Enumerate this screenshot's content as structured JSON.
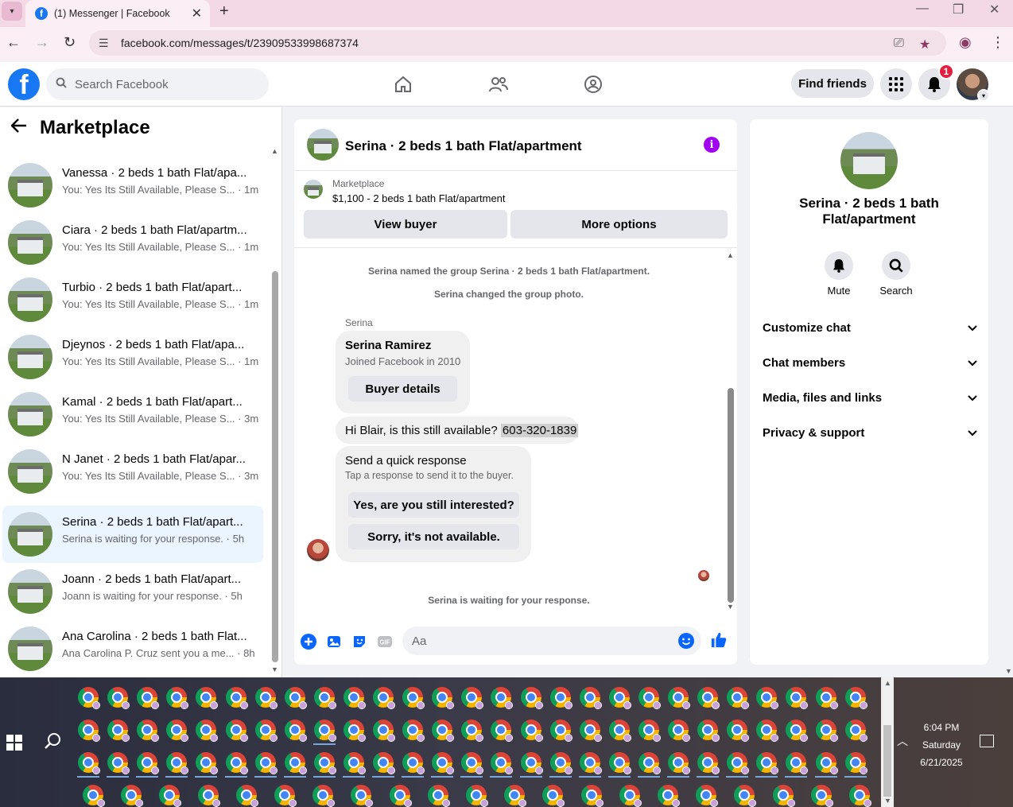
{
  "browser": {
    "tab_title": "(1) Messenger | Facebook",
    "url": "facebook.com/messages/t/23909533998687374"
  },
  "fb_header": {
    "search_placeholder": "Search Facebook",
    "find_friends_label": "Find friends",
    "notification_count": "1"
  },
  "sidebar": {
    "title": "Marketplace",
    "conversations": [
      {
        "name": "Vanessa · 2 beds 1 bath Flat/apa...",
        "snippet": "You: Yes Its Still Available, Please S... · 1m"
      },
      {
        "name": "Ciara · 2 beds 1 bath Flat/apartm...",
        "snippet": "You: Yes Its Still Available, Please S... · 1m"
      },
      {
        "name": "Turbio · 2 beds 1 bath Flat/apart...",
        "snippet": "You: Yes Its Still Available, Please S... · 1m"
      },
      {
        "name": "Djeynos · 2 beds 1 bath Flat/apa...",
        "snippet": "You: Yes Its Still Available, Please S... · 1m"
      },
      {
        "name": "Kamal · 2 beds 1 bath Flat/apart...",
        "snippet": "You: Yes Its Still Available, Please S... · 3m"
      },
      {
        "name": "N Janet · 2 beds 1 bath Flat/apar...",
        "snippet": "You: Yes Its Still Available, Please S... · 3m"
      },
      {
        "name": "Serina · 2 beds 1 bath Flat/apart...",
        "snippet": "Serina is waiting for your response. · 5h"
      },
      {
        "name": "Joann · 2 beds 1 bath Flat/apart...",
        "snippet": "Joann is waiting for your response. · 5h"
      },
      {
        "name": "Ana Carolina · 2 beds 1 bath Flat...",
        "snippet": "Ana Carolina P. Cruz sent you a me... · 8h"
      }
    ]
  },
  "chat": {
    "title": "Serina · 2 beds 1 bath Flat/apartment",
    "listing_source": "Marketplace",
    "listing_price_title": "$1,100 - 2 beds 1 bath Flat/apartment",
    "view_buyer_label": "View buyer",
    "more_options_label": "More options",
    "system_messages": [
      "Serina named the group Serina · 2 beds 1 bath Flat/apartment.",
      "Serina changed the group photo."
    ],
    "sender_name": "Serina",
    "buyer_card": {
      "name": "Serina Ramirez",
      "joined": "Joined Facebook in 2010",
      "button": "Buyer details"
    },
    "message_text": "Hi Blair, is this still available?",
    "message_phone": "603-320-1839",
    "quick_response": {
      "title": "Send a quick response",
      "subtitle": "Tap a response to send it to the buyer.",
      "option_1": "Yes, are you still interested?",
      "option_2": "Sorry, it's not available."
    },
    "waiting_text": "Serina is waiting for your response.",
    "composer_placeholder": "Aa"
  },
  "info_panel": {
    "title": "Serina · 2 beds 1 bath Flat/apartment",
    "mute_label": "Mute",
    "search_label": "Search",
    "sections": [
      "Customize chat",
      "Chat members",
      "Media, files and links",
      "Privacy & support"
    ]
  },
  "taskbar": {
    "time": "6:04 PM",
    "day": "Saturday",
    "date": "6/21/2025"
  },
  "colors": {
    "fb_blue": "#1877f2",
    "info_purple": "#a100f2",
    "notification_red": "#e41e3f"
  }
}
